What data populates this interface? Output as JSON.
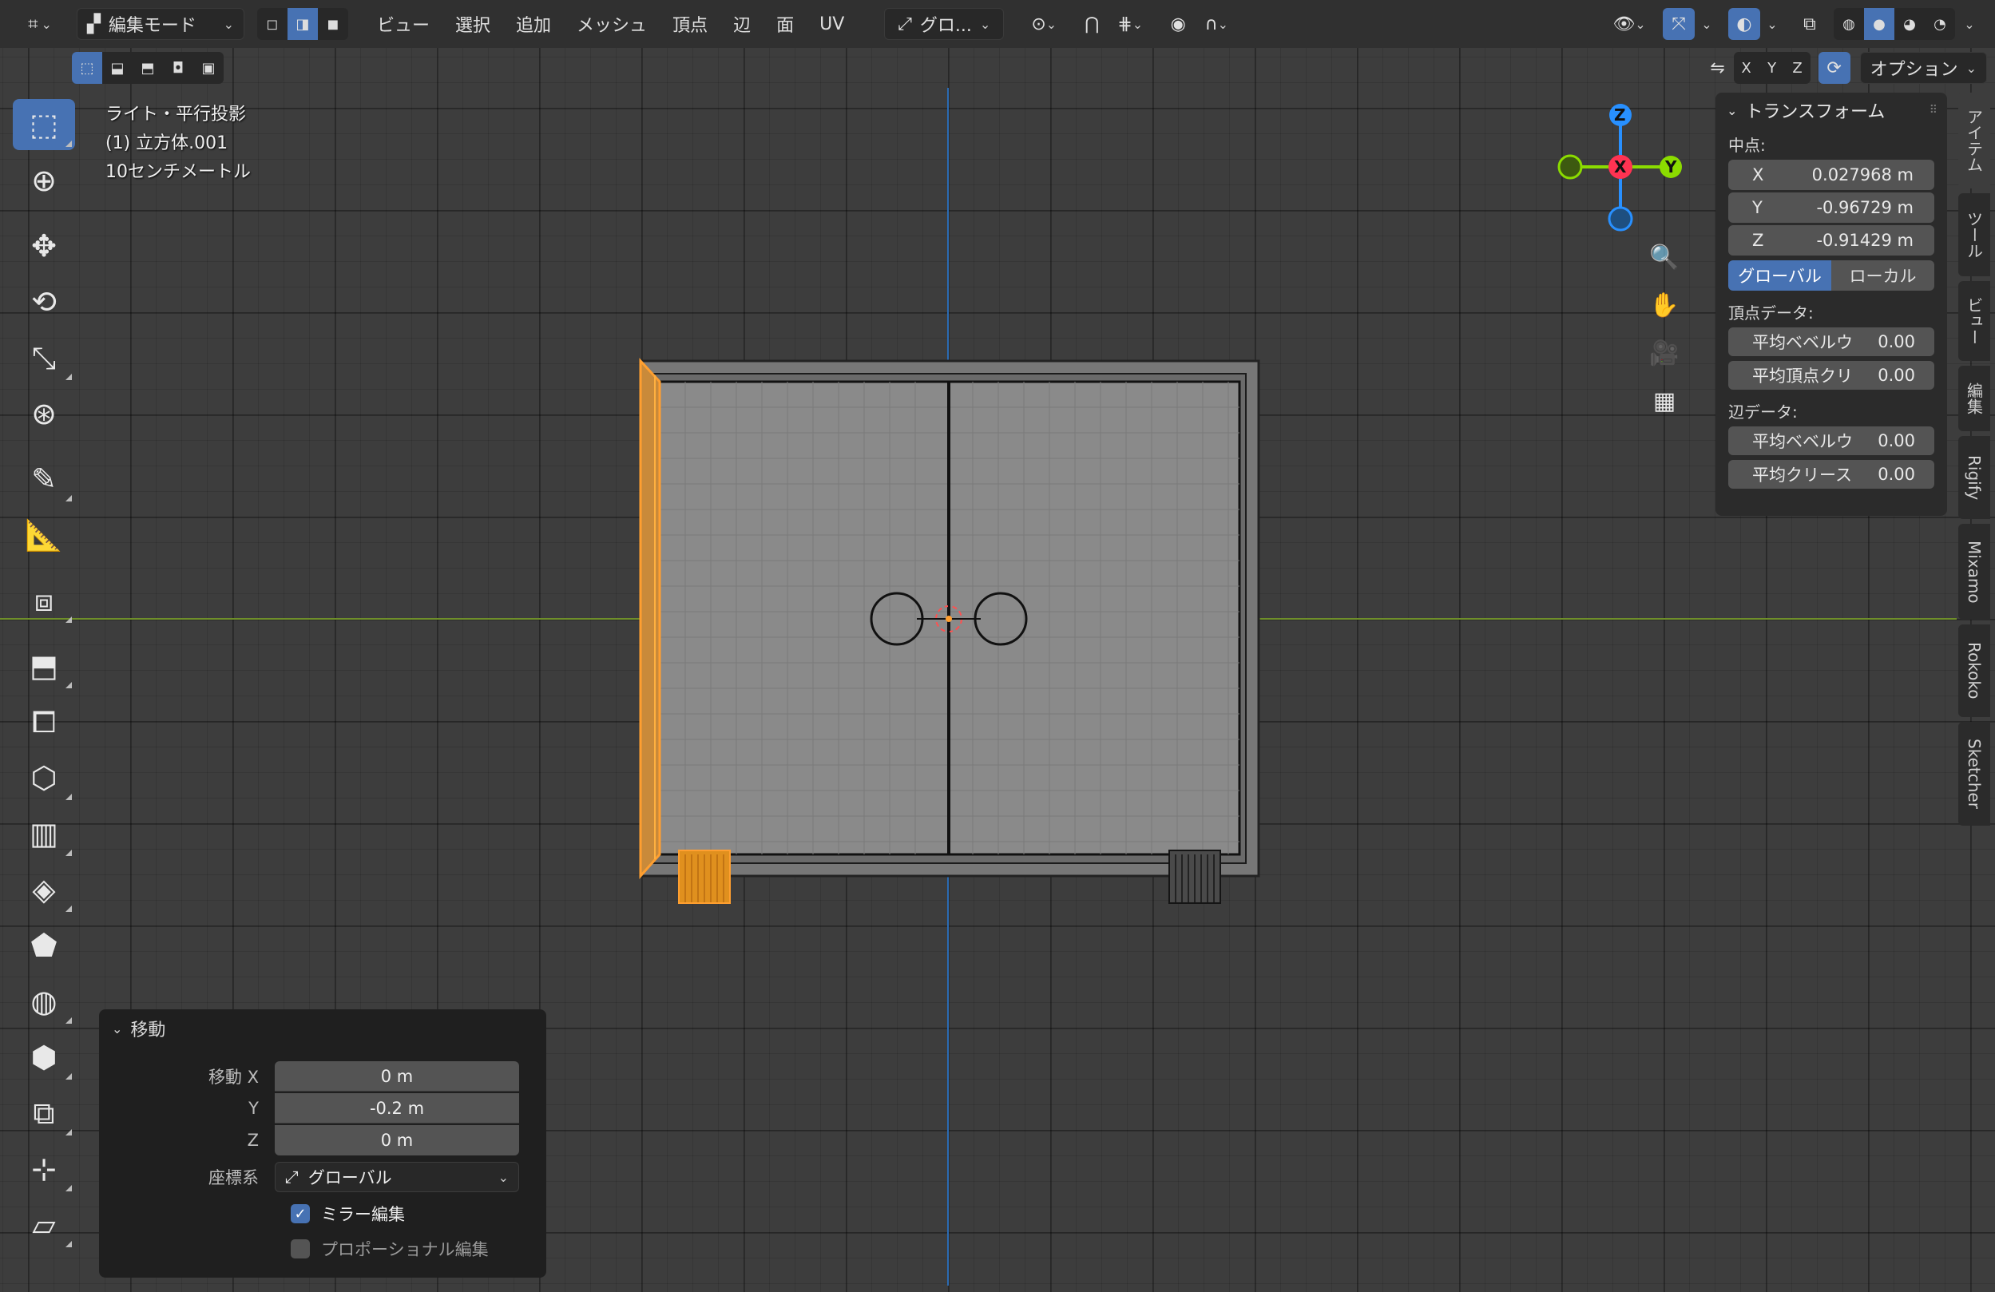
{
  "header": {
    "editor_icon": "editor-type-icon",
    "mode_label": "編集モード",
    "menus": [
      "ビュー",
      "選択",
      "追加",
      "メッシュ",
      "頂点",
      "辺",
      "面",
      "UV"
    ],
    "orientation_label": "グロ...",
    "option_label": "オプション",
    "axis_x": "X",
    "axis_y": "Y",
    "axis_z": "Z"
  },
  "overlay_info": {
    "line1": "ライト・平行投影",
    "line2": "(1) 立方体.001",
    "line3": "10センチメートル"
  },
  "gizmo": {
    "x_label": "X",
    "y_label": "Y",
    "z_label": "Z",
    "colors": {
      "x": "#ff3352",
      "y": "#8bdc00",
      "z": "#2890ff"
    }
  },
  "npanel": {
    "title": "トランスフォーム",
    "median_label": "中点:",
    "median": [
      {
        "axis": "X",
        "value": "0.027968 m"
      },
      {
        "axis": "Y",
        "value": "-0.96729 m"
      },
      {
        "axis": "Z",
        "value": "-0.91429 m"
      }
    ],
    "global_label": "グローバル",
    "local_label": "ローカル",
    "vertex_data_label": "頂点データ:",
    "vertex_fields": [
      {
        "label": "平均ベベルウ",
        "value": "0.00"
      },
      {
        "label": "平均頂点クリ",
        "value": "0.00"
      }
    ],
    "edge_data_label": "辺データ:",
    "edge_fields": [
      {
        "label": "平均ベベルウ",
        "value": "0.00"
      },
      {
        "label": "平均クリース",
        "value": "0.00"
      }
    ]
  },
  "side_tabs": [
    "アイテム",
    "ツール",
    "ビュー",
    "編集",
    "Rigify",
    "Mixamo",
    "Rokoko",
    "Sketcher"
  ],
  "operator": {
    "title": "移動",
    "move_x_label": "移動 X",
    "move_x": "0 m",
    "y_label": "Y",
    "move_y": "-0.2 m",
    "z_label": "Z",
    "move_z": "0 m",
    "coord_label": "座標系",
    "coord_value": "グローバル",
    "mirror_label": "ミラー編集",
    "mirror_checked": true,
    "proportional_label": "プロポーショナル編集",
    "proportional_checked": false
  },
  "colors": {
    "accent": "#4772b3",
    "selection": "#ff9f30",
    "x_axis_line": "#7a9a2a",
    "y_axis_line": "#2b6bb3"
  }
}
